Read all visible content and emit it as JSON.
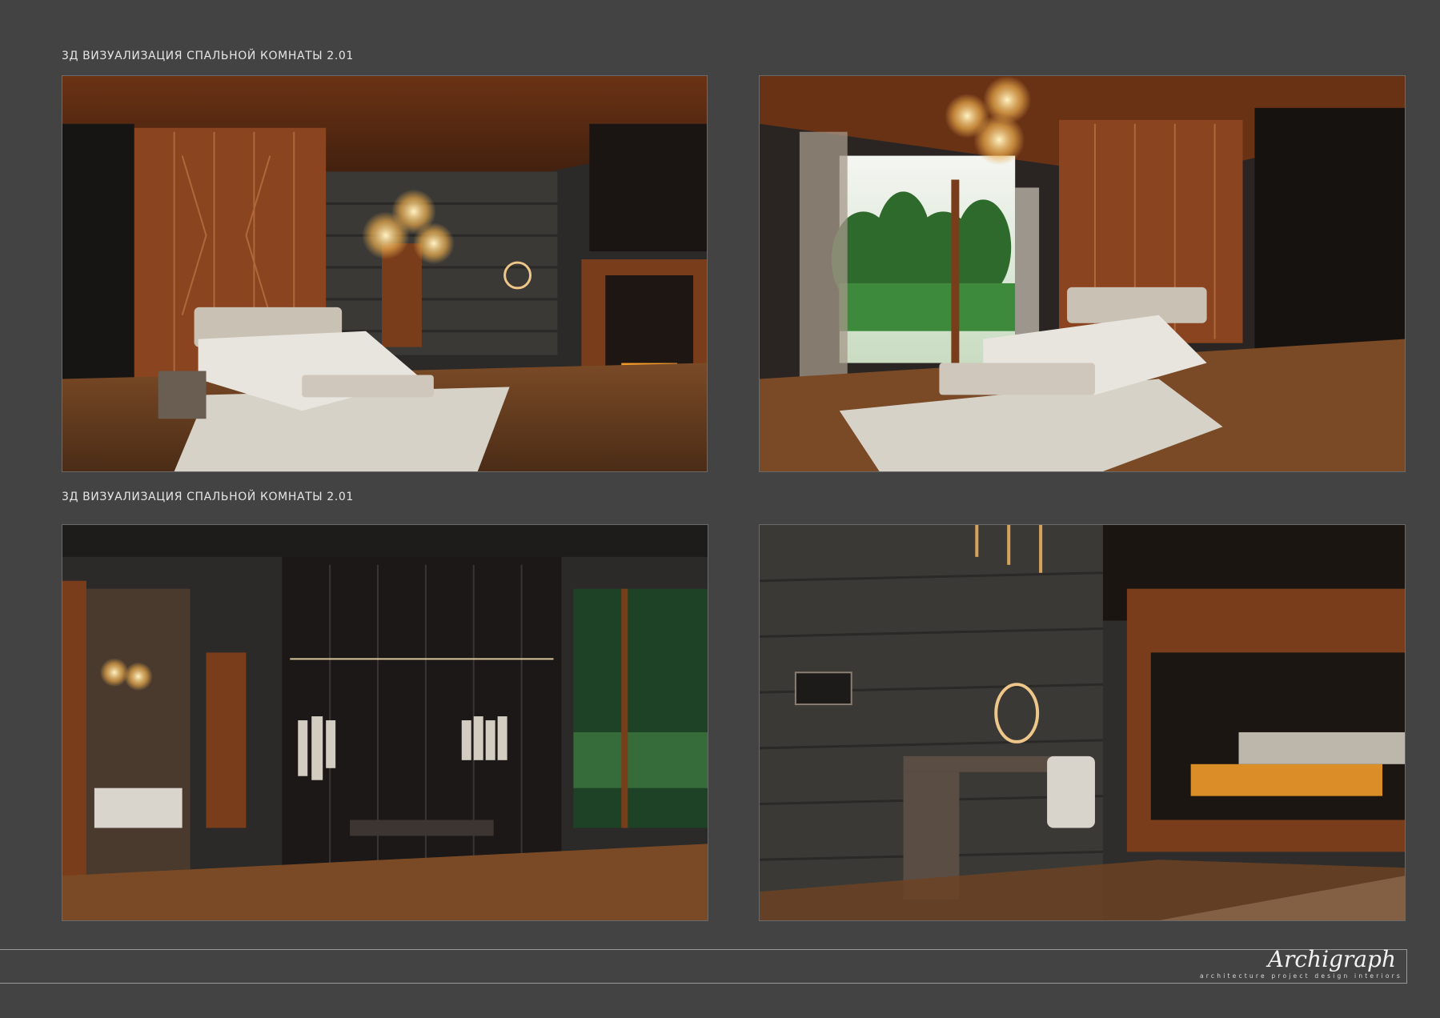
{
  "sections": [
    {
      "title": "3Д ВИЗУАЛИЗАЦИЯ СПАЛЬНОЙ КОМНАТЫ 2.01"
    },
    {
      "title": "3Д ВИЗУАЛИЗАЦИЯ СПАЛЬНОЙ КОМНАТЫ 2.01"
    }
  ],
  "renders": [
    {
      "subject": "bedroom-view-bed-fireplace"
    },
    {
      "subject": "bedroom-view-balcony"
    },
    {
      "subject": "bedroom-view-wardrobe"
    },
    {
      "subject": "bedroom-view-vanity-fireplace"
    }
  ],
  "logo": {
    "script": "Archigraph",
    "tagline": "architecture  project  design  interiors"
  },
  "colors": {
    "background": "#434343",
    "wood": "#7a3f1f",
    "log": "#3a3a38",
    "linen": "#d9d4cc"
  }
}
